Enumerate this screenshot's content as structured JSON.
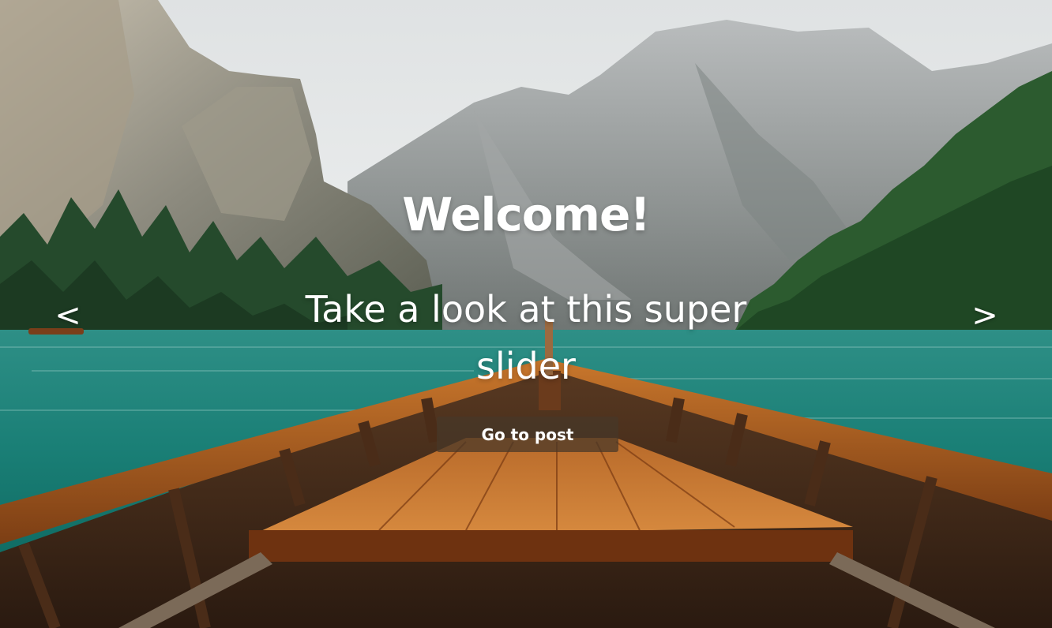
{
  "slide": {
    "title": "Welcome!",
    "subtitle": "Take a look at this super slider",
    "button_label": "Go to post"
  },
  "controls": {
    "prev_label": "<",
    "next_label": ">",
    "prev_icon": "chevron-left-icon",
    "next_icon": "chevron-right-icon"
  },
  "colors": {
    "text": "#ffffff",
    "button_bg": "#46372880",
    "water": "#1f8a80",
    "sky": "#e6e8e9"
  }
}
